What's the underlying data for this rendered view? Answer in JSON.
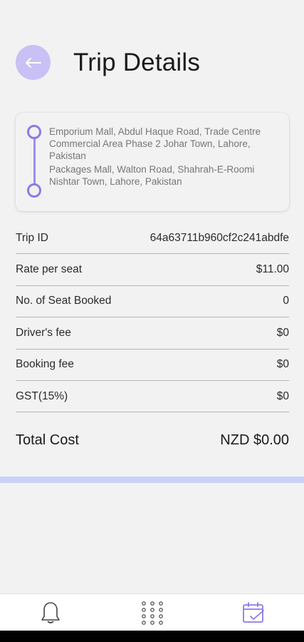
{
  "header": {
    "title": "Trip Details"
  },
  "route": {
    "from": "Emporium Mall, Abdul Haque Road, Trade Centre Commercial Area Phase 2 Johar Town, Lahore, Pakistan",
    "to": "Packages Mall, Walton Road, Shahrah-E-Roomi Nishtar Town, Lahore, Pakistan"
  },
  "details": [
    {
      "label": "Trip ID",
      "value": "64a63711b960cf2c241abdfe"
    },
    {
      "label": "Rate per seat",
      "value": "$11.00"
    },
    {
      "label": "No. of Seat Booked",
      "value": "0"
    },
    {
      "label": "Driver's fee",
      "value": "$0"
    },
    {
      "label": "Booking fee",
      "value": "$0"
    },
    {
      "label": "GST(15%)",
      "value": "$0"
    }
  ],
  "total": {
    "label": "Total Cost",
    "value": "NZD $0.00"
  },
  "nav": {
    "items": [
      {
        "icon": "bell-icon",
        "active": false
      },
      {
        "icon": "grid-icon",
        "active": false
      },
      {
        "icon": "calendar-check-icon",
        "active": true
      }
    ]
  },
  "colors": {
    "accent": "#8b7be8",
    "back_button_bg": "#c9c0f5",
    "divider_bar": "#c8d1f7",
    "background": "#f2f2f2"
  }
}
